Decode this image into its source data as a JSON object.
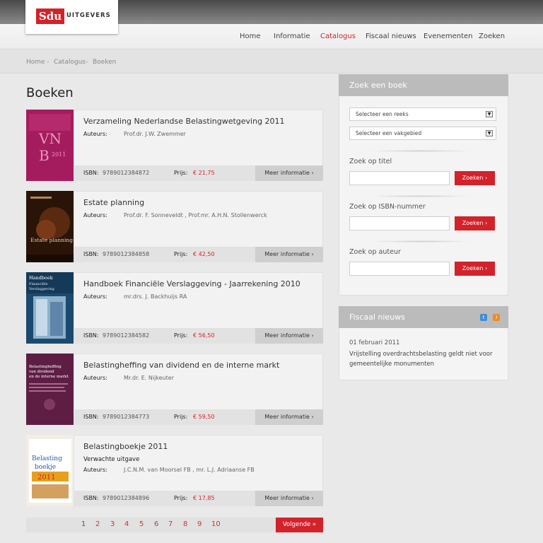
{
  "brand": {
    "logo_mark": "Sdu",
    "logo_text": "UITGEVERS",
    "accent_color": "#d3222a"
  },
  "nav": {
    "items": [
      "Home",
      "Informatie",
      "Catalogus",
      "Fiscaal nieuws",
      "Evenementen",
      "Zoeken"
    ],
    "active": "Catalogus"
  },
  "breadcrumb": [
    "Home",
    "Catalogus",
    "Boeken"
  ],
  "page_title": "Boeken",
  "labels": {
    "auteurs": "Auteurs:",
    "isbn": "ISBN:",
    "prijs": "Prijs:",
    "meer": "Meer informatie  ›"
  },
  "books": [
    {
      "title": "Verzameling Nederlandse Belastingwetgeving 2011",
      "subtitle": "",
      "authors": "Prof.dr. J.W. Zwemmer",
      "isbn": "9789012384872",
      "price": "€ 21,75",
      "cover_text": "VNB 2011"
    },
    {
      "title": "Estate planning",
      "subtitle": "",
      "authors": "Prof.dr. F. Sonneveldt , Prof.mr. A.H.N. Stollenwerck",
      "isbn": "9789012384858",
      "price": "€ 42,50",
      "cover_text": "Estate planning"
    },
    {
      "title": "Handboek Financiële Verslaggeving - Jaarrekening 2010",
      "subtitle": "",
      "authors": "mr.drs. J. Backhuijs RA",
      "isbn": "9789012384582",
      "price": "€ 56,50",
      "cover_text": "Handboek Financiële Verslaggeving"
    },
    {
      "title": "Belastingheffing van dividend en de interne markt",
      "subtitle": "",
      "authors": "Mr.dr. E. Nijkeuter",
      "isbn": "9789012384773",
      "price": "€ 59,50",
      "cover_text": "Belastingheffing van dividend en de interne markt"
    },
    {
      "title": "Belastingboekje 2011",
      "subtitle": "Verwachte uitgave",
      "authors": "J.C.N.M. van Moorsel FB , mr. L.J. Adriaanse FB",
      "isbn": "9789012384896",
      "price": "€ 17,85",
      "cover_text": "Belasting boekje 2011"
    }
  ],
  "pagination": {
    "pages": [
      "1",
      "2",
      "3",
      "4",
      "5",
      "6",
      "7",
      "8",
      "9",
      "10"
    ],
    "current": "1",
    "next_label": "Volgende »"
  },
  "search_panel": {
    "title": "Zoek een boek",
    "select_reeks": "Selecteer een reeks",
    "select_vakgebied": "Selecteer een vakgebied",
    "titel_label": "Zoek op titel",
    "isbn_label": "Zoek op ISBN-nummer",
    "auteur_label": "Zoek op auteur",
    "button_label": "Zoeken  ›"
  },
  "news_panel": {
    "title": "Fiscaal nieuws",
    "date": "01 februari 2011",
    "text": "Vrijstelling overdrachtsbelasting geldt niet voor gemeentelijke monumenten"
  }
}
